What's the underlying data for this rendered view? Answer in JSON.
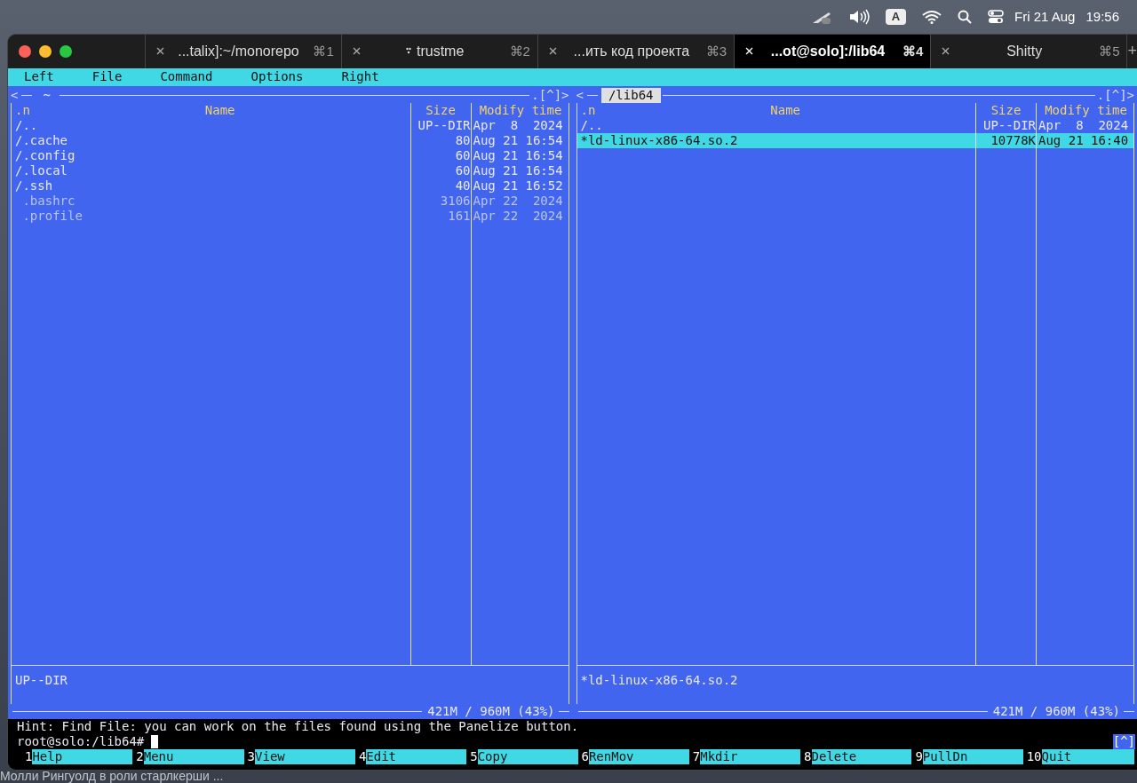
{
  "menubar": {
    "date": "Fri 21 Aug",
    "time": "19:56",
    "input_source": "A"
  },
  "tabs": [
    {
      "label": "...talix]:~/monorepo",
      "shortcut": "⌘1",
      "selected": false,
      "kind": "plain"
    },
    {
      "label": "trustme",
      "shortcut": "⌘2",
      "selected": false,
      "kind": "activity"
    },
    {
      "label": "...ить код проекта",
      "shortcut": "⌘3",
      "selected": false,
      "kind": "plain"
    },
    {
      "label": "...ot@solo]:/lib64",
      "shortcut": "⌘4",
      "selected": true,
      "kind": "plain"
    },
    {
      "label": "Shitty",
      "shortcut": "⌘5",
      "selected": false,
      "kind": "plain"
    }
  ],
  "new_tab": "+",
  "mc_menu": [
    "Left",
    "File",
    "Command",
    "Options",
    "Right"
  ],
  "panels": [
    {
      "path": "~",
      "active": false,
      "left_marker": "<",
      "right_marker": ".[^]>",
      "columns": [
        ".n",
        "Name",
        "Size",
        "Modify time"
      ],
      "rows": [
        {
          "name": "/..",
          "size": "UP--DIR",
          "date": "Apr  8  2024",
          "kind": "dir",
          "selected": false
        },
        {
          "name": "/.cache",
          "size": "80",
          "date": "Aug 21 16:54",
          "kind": "dir",
          "selected": false
        },
        {
          "name": "/.config",
          "size": "60",
          "date": "Aug 21 16:54",
          "kind": "dir",
          "selected": false
        },
        {
          "name": "/.local",
          "size": "60",
          "date": "Aug 21 16:54",
          "kind": "dir",
          "selected": false
        },
        {
          "name": "/.ssh",
          "size": "40",
          "date": "Aug 21 16:52",
          "kind": "dir",
          "selected": false
        },
        {
          "name": " .bashrc",
          "size": "3106",
          "date": "Apr 22  2024",
          "kind": "file",
          "selected": false
        },
        {
          "name": " .profile",
          "size": "161",
          "date": "Apr 22  2024",
          "kind": "file",
          "selected": false
        }
      ],
      "status": "UP--DIR",
      "disk": "421M / 960M (43%)"
    },
    {
      "path": "/lib64",
      "active": true,
      "left_marker": "<",
      "right_marker": ".[^]>",
      "columns": [
        ".n",
        "Name",
        "Size",
        "Modify time"
      ],
      "rows": [
        {
          "name": "/..",
          "size": "UP--DIR",
          "date": "Apr  8  2024",
          "kind": "dir",
          "selected": false
        },
        {
          "name": "*ld-linux-x86-64.so.2",
          "size": "10778K",
          "date": "Aug 21 16:40",
          "kind": "exec",
          "selected": true
        }
      ],
      "status": "*ld-linux-x86-64.so.2",
      "disk": "421M / 960M (43%)"
    }
  ],
  "hint": "Hint: Find File: you can work on the files found using the Panelize button.",
  "prompt": "root@solo:/lib64#",
  "history_marker": "[^]",
  "function_keys": [
    {
      "number": "1",
      "label": "Help"
    },
    {
      "number": "2",
      "label": "Menu"
    },
    {
      "number": "3",
      "label": "View"
    },
    {
      "number": "4",
      "label": "Edit"
    },
    {
      "number": "5",
      "label": "Copy"
    },
    {
      "number": "6",
      "label": "RenMov"
    },
    {
      "number": "7",
      "label": "Mkdir"
    },
    {
      "number": "8",
      "label": "Delete"
    },
    {
      "number": "9",
      "label": "PullDn"
    },
    {
      "number": "10",
      "label": "Quit"
    }
  ],
  "background_text": "Молли Рингуолд в роли старлкерши ..."
}
